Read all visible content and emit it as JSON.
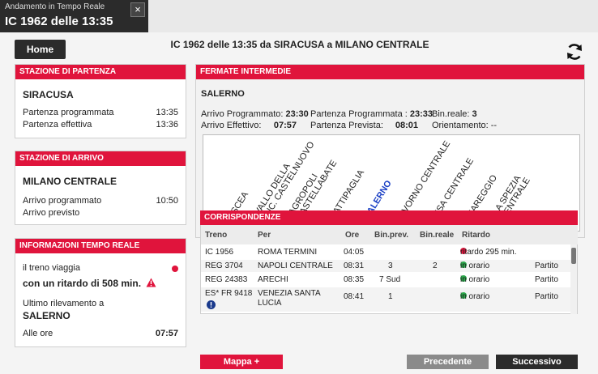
{
  "window": {
    "app_name": "Andamento in Tempo Reale",
    "title": "IC 1962 delle 13:35",
    "close": "×"
  },
  "header": {
    "home_label": "Home",
    "page_title": "IC 1962 delle 13:35 da SIRACUSA a MILANO CENTRALE"
  },
  "departure": {
    "header": "STAZIONE DI PARTENZA",
    "station": "SIRACUSA",
    "scheduled_label": "Partenza programmata",
    "scheduled_time": "13:35",
    "actual_label": "Partenza effettiva",
    "actual_time": "13:36"
  },
  "arrival": {
    "header": "STAZIONE DI ARRIVO",
    "station": "MILANO CENTRALE",
    "scheduled_label": "Arrivo programmato",
    "scheduled_time": "10:50",
    "expected_label": "Arrivo previsto",
    "expected_time": ""
  },
  "realtime": {
    "header": "INFORMAZIONI TEMPO REALE",
    "travel_label": "il treno viaggia",
    "delay_text": "con un ritardo di 508 min.",
    "last_detection_label": "Ultimo rilevamento a",
    "last_station": "SALERNO",
    "time_label": "Alle ore",
    "time_value": "07:57"
  },
  "stops": {
    "header": "FERMATE INTERMEDIE",
    "station": "SALERNO",
    "arr_sched_label": "Arrivo Programmato:",
    "arr_sched": "23:30",
    "arr_actual_label": "Arrivo Effettivo:",
    "arr_actual": "07:57",
    "dep_sched_label": "Partenza Programmata :",
    "dep_sched": "23:33",
    "dep_expected_label": "Partenza Prevista:",
    "dep_expected": "08:01",
    "platform_label": "Bin.reale:",
    "platform": "3",
    "orientation_label": "Orientamento:",
    "orientation": "--",
    "map_stops": [
      "ASCEA",
      "VALLO DELLA\nLUC. CASTELNUOVO",
      "AGROPOLI\nCASTELLABATE",
      "BATTIPAGLIA",
      "SALERNO",
      "LIVORNO CENTRALE",
      "PISA CENTRALE",
      "VIAREGGIO",
      "LA SPEZIA\nCENTRALE"
    ],
    "current_index": 4,
    "colors": {
      "passed": "#1a3fc4",
      "future": "#9a9a9a",
      "current": "#1a3fc4",
      "arrow": "#e0143c"
    }
  },
  "connections": {
    "header": "CORRISPONDENZE",
    "columns": [
      "Treno",
      "Per",
      "Ore",
      "Bin.prev.",
      "Bin.reale",
      "Ritardo"
    ],
    "rows": [
      {
        "train": "IC 1956",
        "to": "ROMA TERMINI",
        "time": "04:05",
        "bin_prev": "",
        "bin_real": "",
        "delay": "ritardo 295 min.",
        "status": "red",
        "note": ""
      },
      {
        "train": "REG 3704",
        "to": "NAPOLI CENTRALE",
        "time": "08:31",
        "bin_prev": "3",
        "bin_real": "2",
        "delay": "in orario",
        "status": "green",
        "note": "Partito"
      },
      {
        "train": "REG 24383",
        "to": "ARECHI",
        "time": "08:35",
        "bin_prev": "7 Sud",
        "bin_real": "",
        "delay": "in orario",
        "status": "green",
        "note": "Partito"
      },
      {
        "train": "ES* FR 9418",
        "to": "VENEZIA SANTA",
        "to2": "LUCIA",
        "time": "08:41",
        "bin_prev": "1",
        "bin_real": "",
        "delay": "in orario",
        "status": "green",
        "note": "Partito"
      }
    ]
  },
  "footer": {
    "map_button": "Mappa +",
    "prev_button": "Precedente",
    "next_button": "Successivo"
  }
}
